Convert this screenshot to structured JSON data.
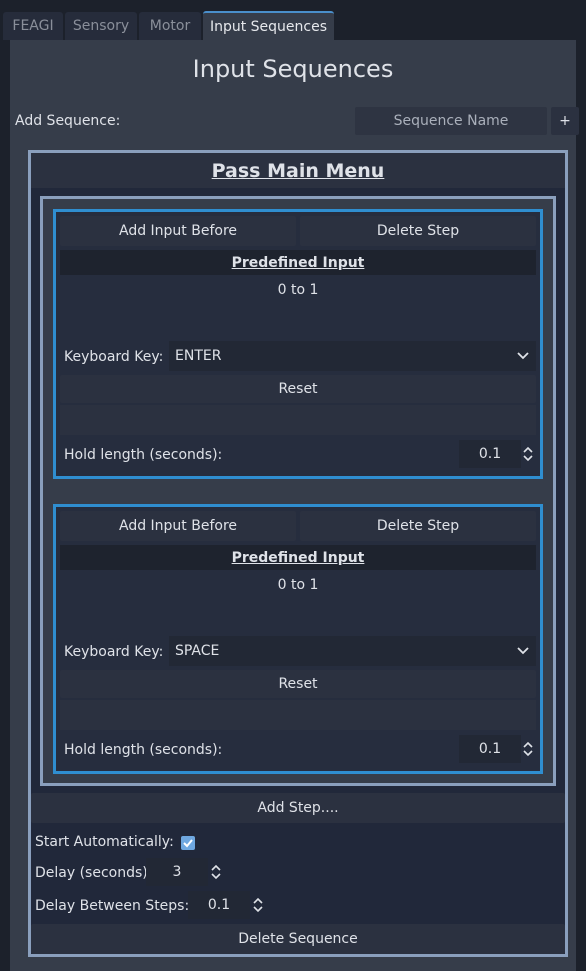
{
  "tabs": [
    {
      "label": "FEAGI"
    },
    {
      "label": "Sensory"
    },
    {
      "label": "Motor"
    },
    {
      "label": "Input Sequences"
    }
  ],
  "page_title": "Input Sequences",
  "add_sequence": {
    "label": "Add Sequence:",
    "placeholder": "Sequence Name",
    "add_button": "+"
  },
  "sequence": {
    "title": "Pass Main Menu",
    "steps": [
      {
        "add_before": "Add Input Before",
        "delete": "Delete Step",
        "predefined_header": "Predefined Input",
        "range": "0 to 1",
        "key_label": "Keyboard Key:",
        "key_value": "ENTER",
        "reset": "Reset",
        "hold_label": "Hold length (seconds):",
        "hold_value": "0.1"
      },
      {
        "add_before": "Add Input Before",
        "delete": "Delete Step",
        "predefined_header": "Predefined Input",
        "range": "0 to 1",
        "key_label": "Keyboard Key:",
        "key_value": "SPACE",
        "reset": "Reset",
        "hold_label": "Hold length (seconds):",
        "hold_value": "0.1"
      }
    ],
    "add_step": "Add Step....",
    "start_auto_label": "Start Automatically:",
    "start_auto_checked": true,
    "delay_label": "Delay (seconds)",
    "delay_value": "3",
    "delay_between_label": "Delay Between Steps:",
    "delay_between_value": "0.1",
    "delete_sequence": "Delete Sequence"
  },
  "icons": {
    "dropdown": "chevron-down-icon",
    "spinner": "spin-arrows-icon",
    "check": "checkmark-icon"
  },
  "colors": {
    "accent": "#4a8fcb",
    "step_border": "#2f8ed0",
    "sequence_border": "#8a9fbd",
    "panel_bg": "#363d4a"
  }
}
